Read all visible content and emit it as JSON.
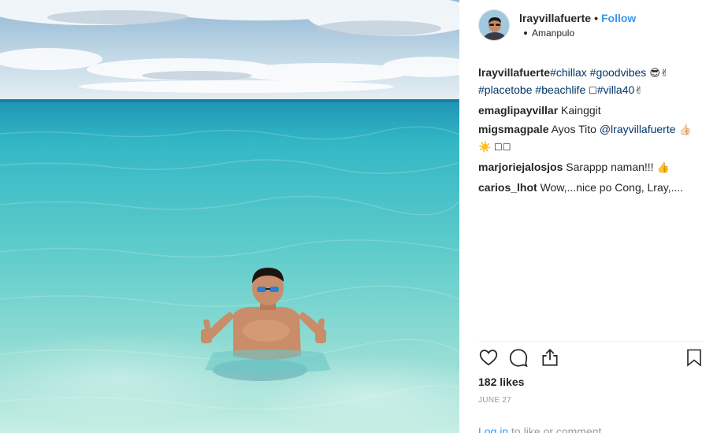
{
  "post": {
    "owner": "lrayvillafuerte",
    "follow_label": "Follow",
    "dot": "•",
    "location": "Amanpulo"
  },
  "comments": [
    {
      "user": "lrayvillafuerte",
      "parts": [
        {
          "type": "tag",
          "text": "#chillax"
        },
        {
          "type": "text",
          "text": " "
        },
        {
          "type": "tag",
          "text": "#goodvibes"
        },
        {
          "type": "emoji",
          "text": " 😎✌"
        },
        {
          "type": "br"
        },
        {
          "type": "tag",
          "text": "#placetobe"
        },
        {
          "type": "text",
          "text": " "
        },
        {
          "type": "tag",
          "text": "#beachlife"
        },
        {
          "type": "box",
          "text": " ☐"
        },
        {
          "type": "tag",
          "text": "#villa40"
        },
        {
          "type": "emoji",
          "text": "✌"
        }
      ]
    },
    {
      "user": "emaglipayvillar",
      "parts": [
        {
          "type": "text",
          "text": " Kainggit"
        }
      ]
    },
    {
      "user": "migsmagpale",
      "parts": [
        {
          "type": "text",
          "text": " Ayos Tito "
        },
        {
          "type": "tag",
          "text": "@lrayvillafuerte"
        },
        {
          "type": "emoji",
          "text": " 👍🏻"
        },
        {
          "type": "br"
        },
        {
          "type": "emoji",
          "text": "☀️"
        },
        {
          "type": "box",
          "text": " ☐☐"
        }
      ]
    },
    {
      "user": "marjoriejalosjos",
      "parts": [
        {
          "type": "text",
          "text": " Sarappp naman!!! "
        },
        {
          "type": "emoji",
          "text": "👍"
        }
      ]
    },
    {
      "user": "carios_lhot",
      "parts": [
        {
          "type": "text",
          "text": " Wow,...nice po Cong, Lray,...."
        }
      ]
    }
  ],
  "likes": "182 likes",
  "date": "JUNE 27",
  "login": {
    "link": "Log in",
    "rest": " to like or comment."
  },
  "icons": {
    "like": "heart-icon",
    "comment": "comment-bubble-icon",
    "share": "share-icon",
    "save": "bookmark-icon"
  }
}
